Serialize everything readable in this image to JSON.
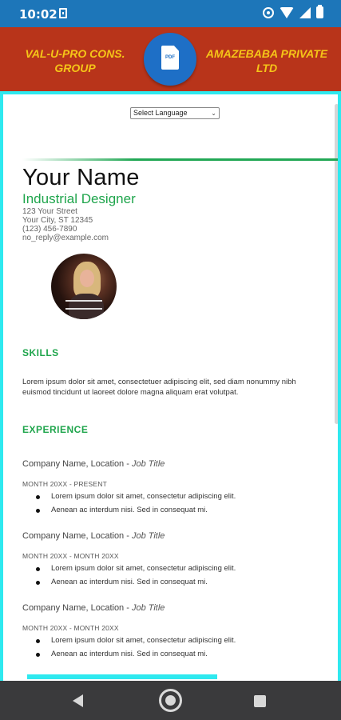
{
  "status_bar": {
    "time": "10:02"
  },
  "app_header": {
    "left_title": "VAL-U-PRO CONS. GROUP",
    "right_title": "AMAZEBABA PRIVATE LTD",
    "pdf_label": "PDF"
  },
  "language": {
    "selected": "Select Language"
  },
  "resume": {
    "name": "Your Name",
    "title": "Industrial Designer",
    "address": [
      "123 Your Street",
      "Your City, ST 12345",
      "(123) 456-7890",
      "no_reply@example.com"
    ],
    "skills_heading": "SKILLS",
    "skills_text": "Lorem ipsum dolor sit amet, consectetuer adipiscing elit, sed diam nonummy nibh euismod tincidunt ut laoreet dolore magna aliquam erat volutpat.",
    "experience_heading": "EXPERIENCE",
    "jobs": [
      {
        "company": "Company Name,  Location - ",
        "job_title": "Job Title",
        "dates": "MONTH 20XX - PRESENT",
        "bullets": [
          "Lorem ipsum dolor sit amet, consectetur adipiscing elit.",
          "Aenean ac interdum nisi. Sed in consequat mi."
        ]
      },
      {
        "company": "Company Name, Location - ",
        "job_title": "Job Title",
        "dates": "MONTH 20XX - MONTH 20XX",
        "bullets": [
          "Lorem ipsum dolor sit amet, consectetur adipiscing elit.",
          "Aenean ac interdum nisi. Sed in consequat mi."
        ]
      },
      {
        "company": "Company Name, Location - ",
        "job_title": "Job Title",
        "dates": "MONTH 20XX - MONTH 20XX",
        "bullets": [
          "Lorem ipsum dolor sit amet, consectetur adipiscing elit.",
          "Aenean ac interdum nisi. Sed in consequat mi."
        ]
      }
    ]
  },
  "colors": {
    "status_bar": "#1d76b9",
    "header": "#b8341a",
    "header_text": "#f5c518",
    "accent_green": "#1fa54c",
    "frame_border": "#2ee9ef",
    "nav_bar": "#3a3a3c"
  }
}
